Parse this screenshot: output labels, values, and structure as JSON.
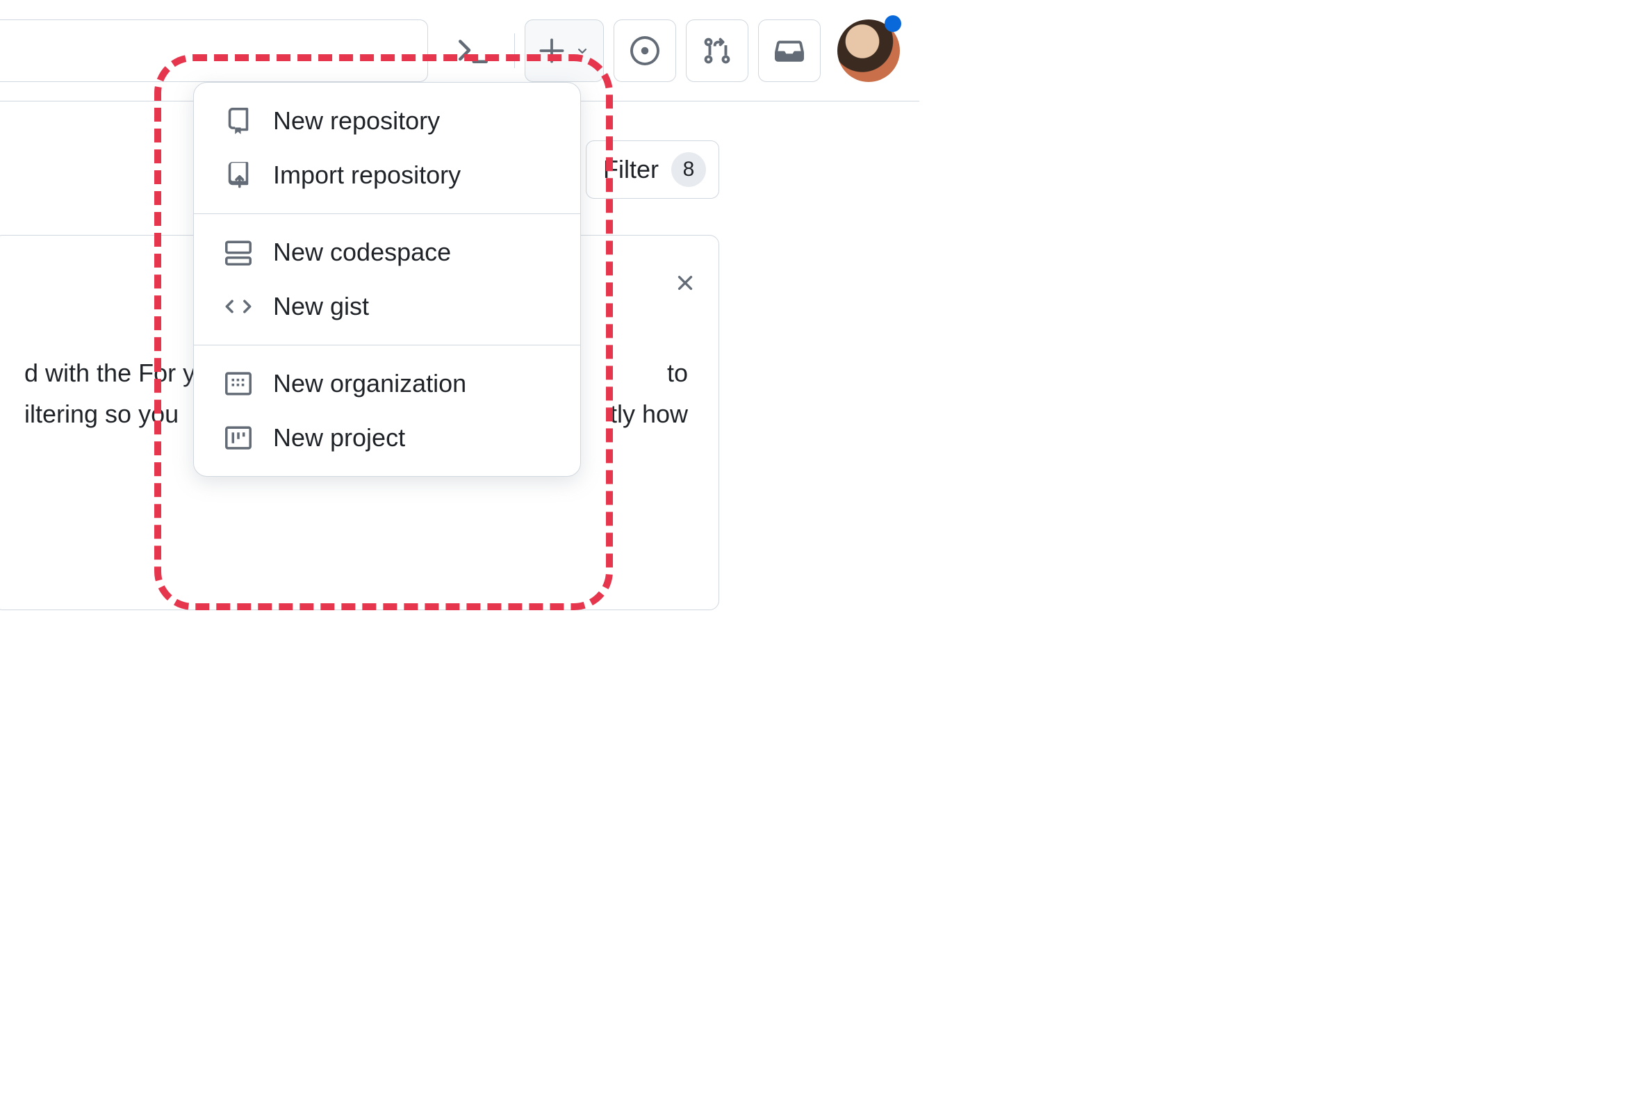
{
  "topbar": {
    "command_palette": "command-palette",
    "create_menu": "create-new",
    "issues": "issues",
    "pull_requests": "pull-requests",
    "inbox": "inbox"
  },
  "filter": {
    "label": "Filter",
    "count": "8"
  },
  "card": {
    "body_line1": "d with the For y",
    "body_line2": "iltering so you ",
    "body_frag1": "to",
    "body_frag2": "tly how"
  },
  "dropdown": {
    "sections": [
      {
        "items": [
          {
            "icon": "repo-icon",
            "label": "New repository"
          },
          {
            "icon": "repo-push-icon",
            "label": "Import repository"
          }
        ]
      },
      {
        "items": [
          {
            "icon": "codespaces-icon",
            "label": "New codespace"
          },
          {
            "icon": "code-icon",
            "label": "New gist"
          }
        ]
      },
      {
        "items": [
          {
            "icon": "organization-icon",
            "label": "New organization"
          },
          {
            "icon": "project-icon",
            "label": "New project"
          }
        ]
      }
    ]
  }
}
